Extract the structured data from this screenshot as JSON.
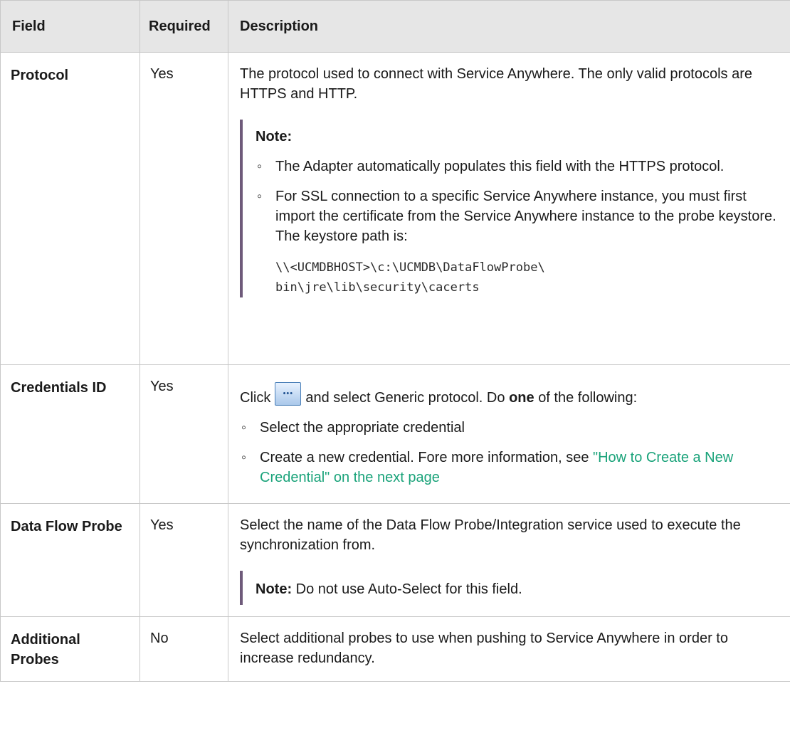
{
  "headers": {
    "field": "Field",
    "required": "Required",
    "description": "Description"
  },
  "rows": [
    {
      "field": "Protocol",
      "required": "Yes",
      "description": "The protocol used to connect with Service Anywhere. The only valid protocols are HTTPS and HTTP.",
      "note_label": "Note:",
      "note_items": [
        "The Adapter automatically populates this field with the HTTPS protocol.",
        "For SSL connection to a specific Service Anywhere instance, you must first import the certificate from the Service Anywhere instance to the probe keystore. The keystore path is:"
      ],
      "code_line1": "\\\\<UCMDBHOST>\\c:\\UCMDB\\DataFlowProbe\\",
      "code_line2": "bin\\jre\\lib\\security\\cacerts"
    },
    {
      "field": "Credentials ID",
      "required": "Yes",
      "click_text": "Click",
      "after_icon_text": "and select Generic protocol. Do",
      "bold_word": "one",
      "after_bold_text": "of the following:",
      "items": [
        "Select the appropriate credential",
        "Create a new credential. Fore more information, see"
      ],
      "link_text": "\"How to Create a New Credential\" on the next page"
    },
    {
      "field": "Data Flow Probe",
      "required": "Yes",
      "description": "Select the name of the Data Flow Probe/Integration service used to execute the synchronization from.",
      "note_label": "Note:",
      "note_text": "Do not use Auto-Select for this field."
    },
    {
      "field": "Additional Probes",
      "required": "No",
      "description": "Select additional probes to use when pushing to Service Anywhere in order to increase redundancy."
    }
  ],
  "icons": {
    "bullet": "◦",
    "browse_button": "ellipsis-browse-icon"
  },
  "colors": {
    "header_bg": "#e6e6e6",
    "note_bar": "#6e5a7a",
    "link": "#1aa37a"
  }
}
